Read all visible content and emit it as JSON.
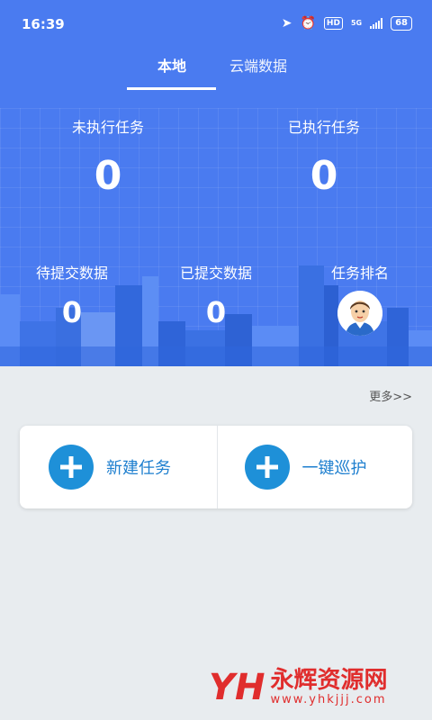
{
  "status_bar": {
    "time": "16:39",
    "network": "5G",
    "hd": "HD",
    "battery": "68",
    "icons": [
      "location-arrow-icon",
      "alarm-icon",
      "hd-icon",
      "5g-icon",
      "signal-icon",
      "battery-icon"
    ]
  },
  "tabs": [
    {
      "label": "本地",
      "active": true
    },
    {
      "label": "云端数据",
      "active": false
    }
  ],
  "stats_top": [
    {
      "label": "未执行任务",
      "value": "0"
    },
    {
      "label": "已执行任务",
      "value": "0"
    }
  ],
  "stats_bottom": [
    {
      "label": "待提交数据",
      "value": "0"
    },
    {
      "label": "已提交数据",
      "value": "0"
    },
    {
      "label": "任务排名"
    }
  ],
  "more_link": "更多>>",
  "actions": [
    {
      "label": "新建任务",
      "icon": "plus-circle-icon"
    },
    {
      "label": "一键巡护",
      "icon": "plus-circle-icon"
    }
  ],
  "watermark": {
    "logo": "YH",
    "name": "永辉资源网",
    "url": "www.yhkjjj.com"
  },
  "colors": {
    "header_bg": "#4a7bf0",
    "accent_blue": "#1e90d8",
    "action_text": "#1e7fcf",
    "page_bg": "#e8ecef",
    "watermark_red": "#e02d2d"
  }
}
